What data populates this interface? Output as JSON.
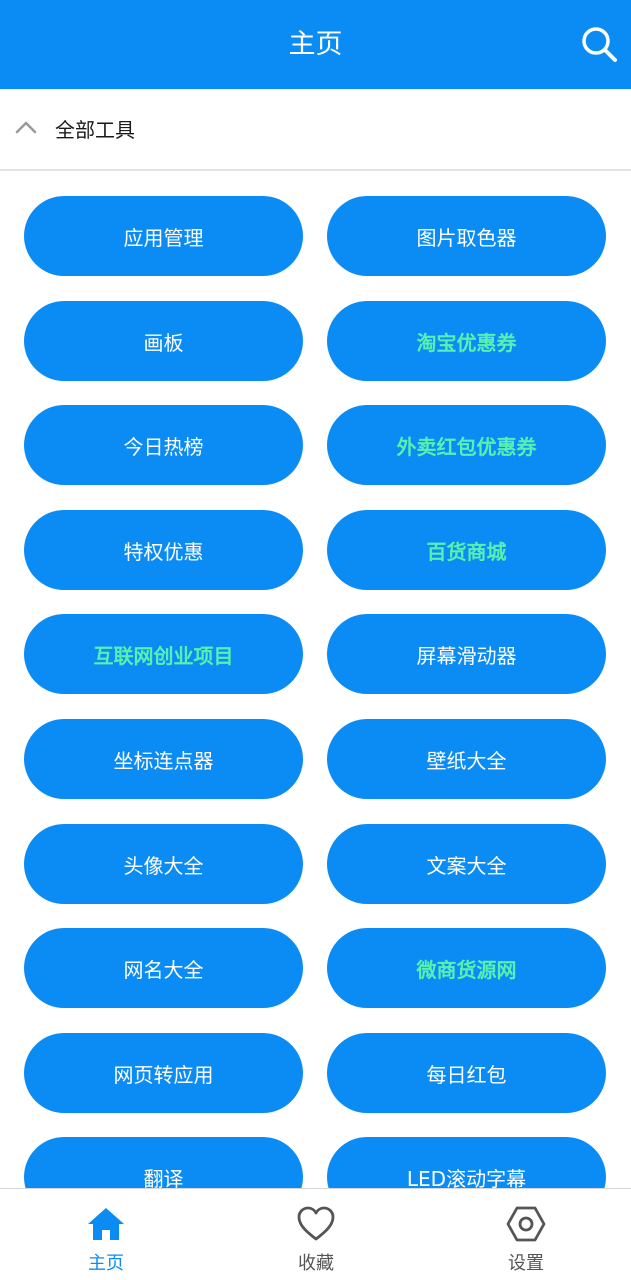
{
  "header": {
    "title": "主页",
    "search_icon": "search-icon"
  },
  "section": {
    "label": "全部工具",
    "toggle_icon": "chevron-up-icon"
  },
  "tools": [
    {
      "name": "应用管理",
      "highlight": false
    },
    {
      "name": "图片取色器",
      "highlight": false
    },
    {
      "name": "画板",
      "highlight": false
    },
    {
      "name": "淘宝优惠券",
      "highlight": true
    },
    {
      "name": "今日热榜",
      "highlight": false
    },
    {
      "name": "外卖红包优惠券",
      "highlight": true
    },
    {
      "name": "特权优惠",
      "highlight": false
    },
    {
      "name": "百货商城",
      "highlight": true
    },
    {
      "name": "互联网创业项目",
      "highlight": true
    },
    {
      "name": "屏幕滑动器",
      "highlight": false
    },
    {
      "name": "坐标连点器",
      "highlight": false
    },
    {
      "name": "壁纸大全",
      "highlight": false
    },
    {
      "name": "头像大全",
      "highlight": false
    },
    {
      "name": "文案大全",
      "highlight": false
    },
    {
      "name": "网名大全",
      "highlight": false
    },
    {
      "name": "微商货源网",
      "highlight": true
    },
    {
      "name": "网页转应用",
      "highlight": false
    },
    {
      "name": "每日红包",
      "highlight": false
    },
    {
      "name": "翻译",
      "highlight": false
    },
    {
      "name": "LED滚动字幕",
      "highlight": false
    }
  ],
  "bottom_nav": [
    {
      "label": "主页",
      "icon": "home-icon",
      "active": true
    },
    {
      "label": "收藏",
      "icon": "heart-icon",
      "active": false
    },
    {
      "label": "设置",
      "icon": "settings-icon",
      "active": false
    }
  ],
  "colors": {
    "primary": "#0b8cf5",
    "highlight_text": "#58f0b0",
    "nav_inactive": "#555555"
  }
}
